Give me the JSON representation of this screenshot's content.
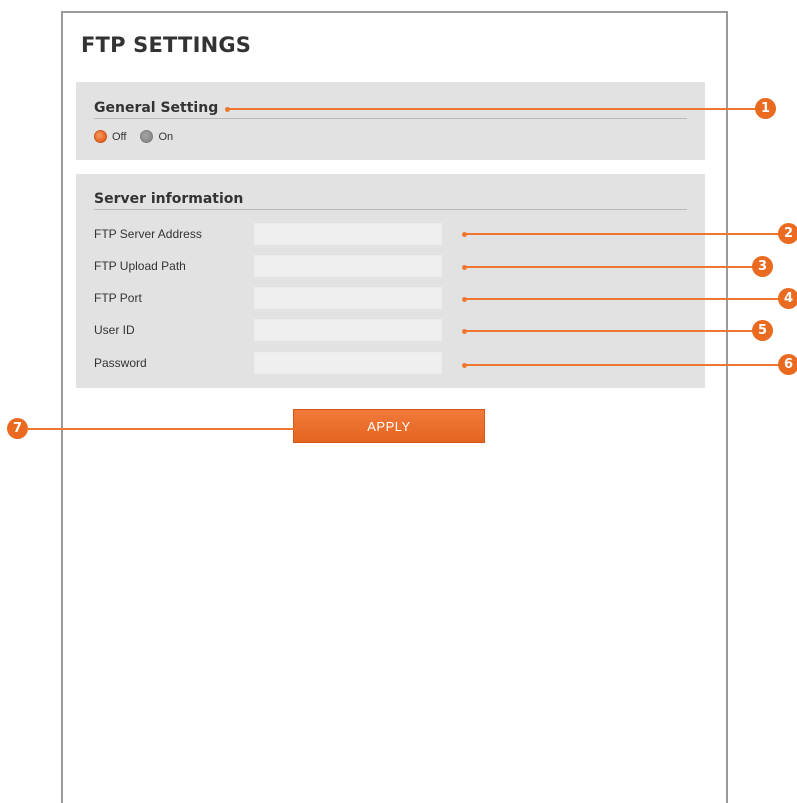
{
  "page": {
    "title": "FTP SETTINGS"
  },
  "general_setting": {
    "title": "General Setting",
    "options": [
      {
        "label": "Off",
        "selected": true
      },
      {
        "label": "On",
        "selected": false
      }
    ]
  },
  "server_information": {
    "title": "Server information",
    "fields": [
      {
        "label": "FTP Server Address",
        "value": ""
      },
      {
        "label": "FTP Upload Path",
        "value": ""
      },
      {
        "label": "FTP Port",
        "value": ""
      },
      {
        "label": "User ID",
        "value": ""
      },
      {
        "label": "Password",
        "value": ""
      }
    ]
  },
  "apply_button": {
    "label": "APPLY"
  },
  "callouts": [
    "1",
    "2",
    "3",
    "4",
    "5",
    "6",
    "7"
  ],
  "colors": {
    "accent": "#ea6a20",
    "panel": "#e2e2e2",
    "frame": "#9a9a9a",
    "text": "#333333"
  }
}
